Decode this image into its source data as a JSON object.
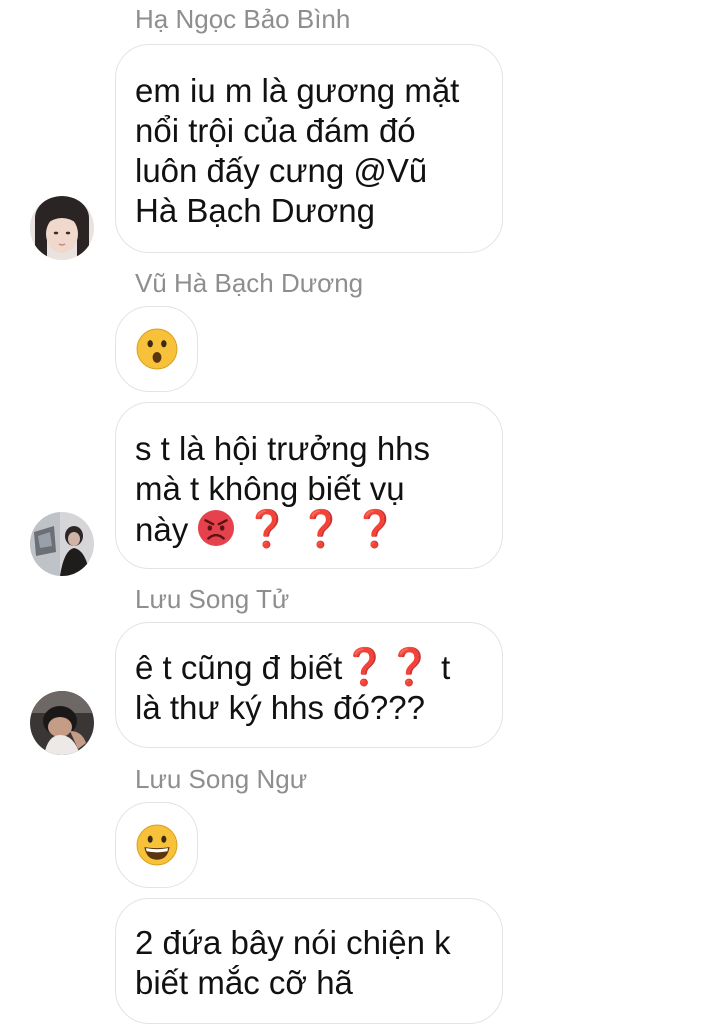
{
  "messages": [
    {
      "sender": "Hạ Ngọc Bảo Bình",
      "lines": [
        "em iu m là gương mặt",
        "nổi trội của đám đó",
        "luôn đấy cưng @Vũ",
        "Hà Bạch Dương"
      ]
    },
    {
      "sender": "Vũ Hà Bạch Dương",
      "emoji": "astonished-face-emoji"
    },
    {
      "lines": [
        "s t là hội trưởng hhs",
        "mà t không biết vụ",
        "này"
      ],
      "trailing_emoji": [
        "angry-face-emoji",
        "red-question-mark",
        "red-question-mark",
        "red-question-mark"
      ],
      "question_mark": "❓"
    },
    {
      "sender": "Lưu Song Tử",
      "line1_start": "ê t cũng đ biết",
      "line1_end": " t",
      "line2": "là thư ký hhs đó???",
      "question_mark": "❓"
    },
    {
      "sender": "Lưu Song Ngư",
      "emoji": "grinning-face-emoji"
    },
    {
      "lines": [
        "2 đứa bây nói chiện k",
        "biết mắc cỡ hã"
      ]
    }
  ],
  "colors": {
    "sender_text": "#8e8e8e",
    "bubble_border": "#e3e3e3",
    "question_red": "#d91f2b",
    "emoji_yellow": "#f7c23a"
  }
}
